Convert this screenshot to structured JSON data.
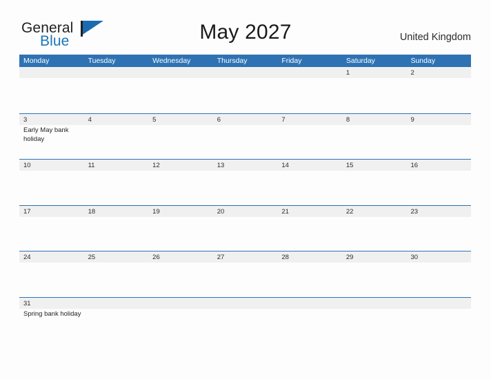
{
  "logo": {
    "word1": "General",
    "word2": "Blue",
    "flag_icon": "triangular-flag-icon",
    "colors": {
      "dark": "#231f20",
      "blue": "#1a75bb"
    }
  },
  "header": {
    "title": "May 2027",
    "country": "United Kingdom"
  },
  "calendar": {
    "accent_color": "#2e72b3",
    "band_color": "#f0f0f0",
    "weekdays": [
      "Monday",
      "Tuesday",
      "Wednesday",
      "Thursday",
      "Friday",
      "Saturday",
      "Sunday"
    ],
    "weeks": [
      [
        {
          "day": "",
          "events": []
        },
        {
          "day": "",
          "events": []
        },
        {
          "day": "",
          "events": []
        },
        {
          "day": "",
          "events": []
        },
        {
          "day": "",
          "events": []
        },
        {
          "day": "1",
          "events": []
        },
        {
          "day": "2",
          "events": []
        }
      ],
      [
        {
          "day": "3",
          "events": [
            "Early May bank holiday"
          ]
        },
        {
          "day": "4",
          "events": []
        },
        {
          "day": "5",
          "events": []
        },
        {
          "day": "6",
          "events": []
        },
        {
          "day": "7",
          "events": []
        },
        {
          "day": "8",
          "events": []
        },
        {
          "day": "9",
          "events": []
        }
      ],
      [
        {
          "day": "10",
          "events": []
        },
        {
          "day": "11",
          "events": []
        },
        {
          "day": "12",
          "events": []
        },
        {
          "day": "13",
          "events": []
        },
        {
          "day": "14",
          "events": []
        },
        {
          "day": "15",
          "events": []
        },
        {
          "day": "16",
          "events": []
        }
      ],
      [
        {
          "day": "17",
          "events": []
        },
        {
          "day": "18",
          "events": []
        },
        {
          "day": "19",
          "events": []
        },
        {
          "day": "20",
          "events": []
        },
        {
          "day": "21",
          "events": []
        },
        {
          "day": "22",
          "events": []
        },
        {
          "day": "23",
          "events": []
        }
      ],
      [
        {
          "day": "24",
          "events": []
        },
        {
          "day": "25",
          "events": []
        },
        {
          "day": "26",
          "events": []
        },
        {
          "day": "27",
          "events": []
        },
        {
          "day": "28",
          "events": []
        },
        {
          "day": "29",
          "events": []
        },
        {
          "day": "30",
          "events": []
        }
      ],
      [
        {
          "day": "31",
          "events": [
            "Spring bank holiday"
          ]
        },
        {
          "day": "",
          "events": []
        },
        {
          "day": "",
          "events": []
        },
        {
          "day": "",
          "events": []
        },
        {
          "day": "",
          "events": []
        },
        {
          "day": "",
          "events": []
        },
        {
          "day": "",
          "events": []
        }
      ]
    ]
  }
}
